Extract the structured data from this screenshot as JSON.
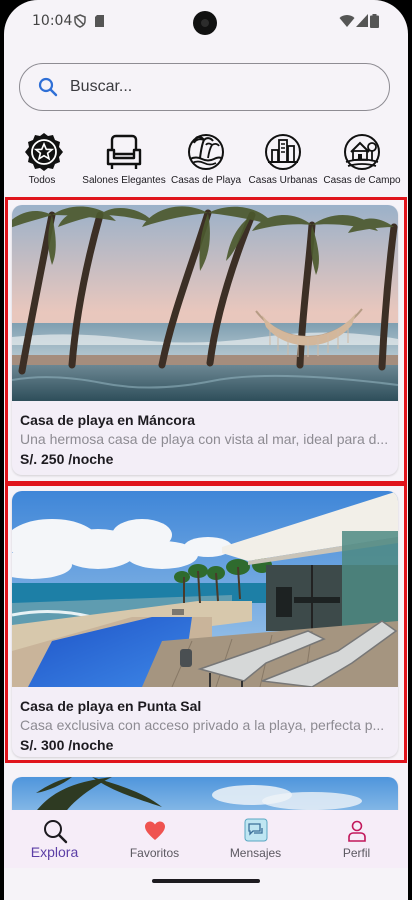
{
  "status_bar": {
    "time": "10:04"
  },
  "search": {
    "placeholder": "Buscar..."
  },
  "categories": [
    {
      "label": "Todos",
      "icon": "star-badge-icon"
    },
    {
      "label": "Salones Elegantes",
      "icon": "armchair-icon"
    },
    {
      "label": "Casas de Playa",
      "icon": "palm-beach-icon"
    },
    {
      "label": "Casas Urbanas",
      "icon": "city-buildings-icon"
    },
    {
      "label": "Casas de Campo",
      "icon": "farmhouse-icon"
    }
  ],
  "listings": [
    {
      "title": "Casa de playa en Máncora",
      "description": "Una hermosa casa de playa con vista al mar, ideal para d...",
      "price": "S/. 250 /noche"
    },
    {
      "title": "Casa de playa en Punta Sal",
      "description": "Casa exclusiva con acceso privado a la playa, perfecta p...",
      "price": "S/. 300 /noche"
    }
  ],
  "bottom_nav": [
    {
      "label": "Explora",
      "icon": "search-icon",
      "active": true
    },
    {
      "label": "Favoritos",
      "icon": "heart-icon",
      "active": false
    },
    {
      "label": "Mensajes",
      "icon": "chat-icon",
      "active": false
    },
    {
      "label": "Perfil",
      "icon": "person-icon",
      "active": false
    }
  ],
  "colors": {
    "accent": "#5c3fa6",
    "highlight_border": "#e0141c",
    "heart": "#ef5350"
  }
}
